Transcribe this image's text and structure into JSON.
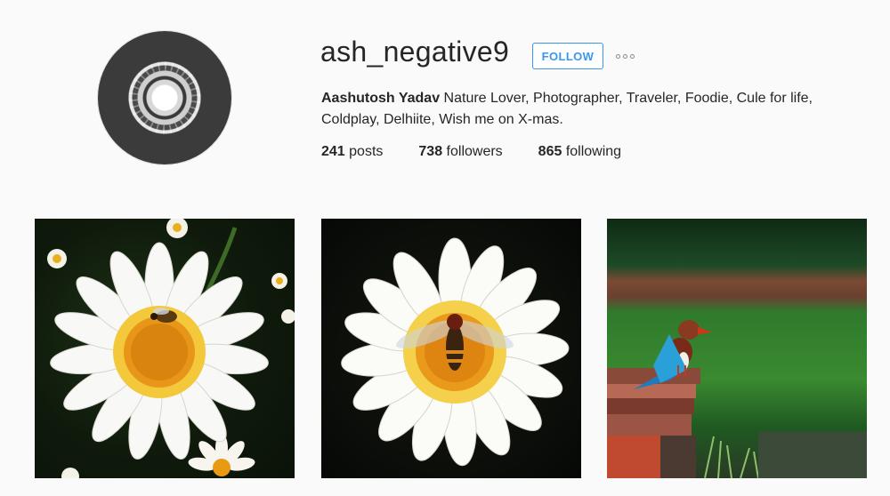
{
  "profile": {
    "username": "ash_negative9",
    "follow_label": "FOLLOW",
    "bio_name": "Aashutosh Yadav",
    "bio_text": " Nature Lover, Photographer, Traveler, Foodie, Cule for life, Coldplay, Delhiite, Wish me on X-mas.",
    "stats": {
      "posts_count": "241",
      "posts_label": " posts",
      "followers_count": "738",
      "followers_label": " followers",
      "following_count": "865",
      "following_label": " following"
    }
  },
  "posts": [
    {
      "subject": "daisy-with-bee"
    },
    {
      "subject": "daisy-with-hoverfly"
    },
    {
      "subject": "kingfisher-on-bench"
    }
  ],
  "colors": {
    "accent": "#3897f0",
    "text": "#262626",
    "background": "#fafafa"
  }
}
